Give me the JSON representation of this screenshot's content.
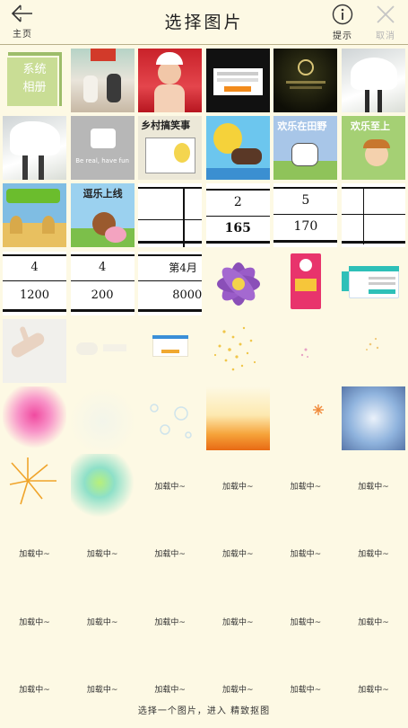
{
  "header": {
    "title": "选择图片",
    "back_label": "主页",
    "hint_label": "提示",
    "cancel_label": "取消"
  },
  "tiles": {
    "system_album": "系统\n相册",
    "comic1_title": "乡村搞笑事",
    "comic2_title": "欢乐在田野",
    "comic3_title": "欢乐至上",
    "comic4_title": "逗乐上线",
    "gray_app_tagline": "Be real, have fun",
    "sheet1_value": "2",
    "sheet1_value2": "165",
    "sheet2_value": "5",
    "sheet2_value2": "170",
    "sheet3_value": "4",
    "sheet3_value2": "1200",
    "sheet4_value": "4",
    "sheet4_value2": "200",
    "sheet5_value": "第4月",
    "sheet5_value2": "8000"
  },
  "loading_label": "加载中~",
  "footer_text": "选择一个图片，进入 精致抠图",
  "colors": {
    "background": "#fdf9e4",
    "divider": "#b8b08a"
  }
}
